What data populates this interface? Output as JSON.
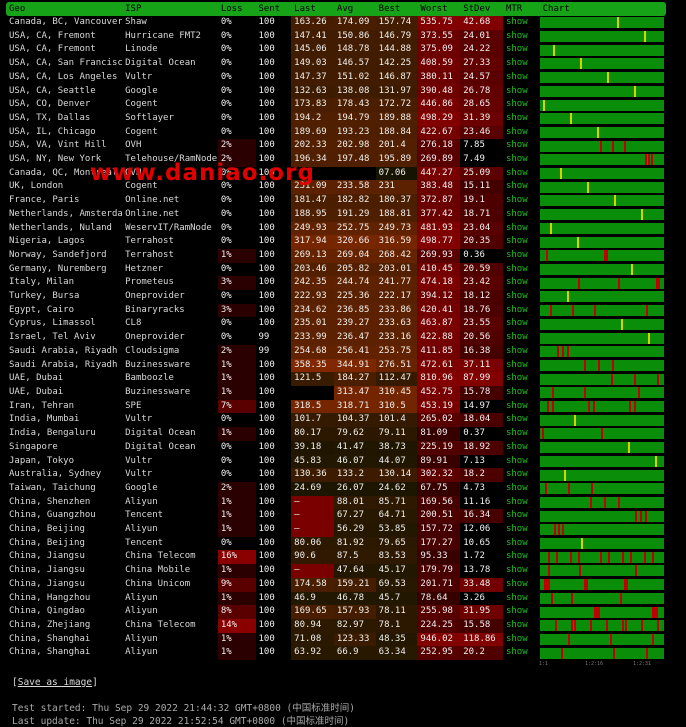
{
  "headers": [
    "Geo",
    "ISP",
    "Loss",
    "Sent",
    "Last",
    "Avg",
    "Best",
    "Worst",
    "StDev",
    "MTR",
    "Chart"
  ],
  "rows": [
    [
      "Canada, BC, Vancouver",
      "Shaw",
      "0%",
      "100",
      "163.26",
      "174.09",
      "157.74",
      "535.75",
      "42.68",
      "show"
    ],
    [
      "USA, CA, Fremont",
      "Hurricane FMT2",
      "0%",
      "100",
      "147.41",
      "150.86",
      "146.79",
      "373.55",
      "24.01",
      "show"
    ],
    [
      "USA, CA, Fremont",
      "Linode",
      "0%",
      "100",
      "145.06",
      "148.78",
      "144.88",
      "375.09",
      "24.22",
      "show"
    ],
    [
      "USA, CA, San Francisco",
      "Digital Ocean",
      "0%",
      "100",
      "149.03",
      "146.57",
      "142.25",
      "408.59",
      "27.33",
      "show"
    ],
    [
      "USA, CA, Los Angeles",
      "Vultr",
      "0%",
      "100",
      "147.37",
      "151.02",
      "146.87",
      "380.11",
      "24.57",
      "show"
    ],
    [
      "USA, CA, Seattle",
      "Google",
      "0%",
      "100",
      "132.63",
      "138.08",
      "131.97",
      "390.48",
      "26.78",
      "show"
    ],
    [
      "USA, CO, Denver",
      "Cogent",
      "0%",
      "100",
      "173.83",
      "178.43",
      "172.72",
      "446.86",
      "28.65",
      "show"
    ],
    [
      "USA, TX, Dallas",
      "Softlayer",
      "0%",
      "100",
      "194.2",
      "194.79",
      "189.88",
      "498.29",
      "31.39",
      "show"
    ],
    [
      "USA, IL, Chicago",
      "Cogent",
      "0%",
      "100",
      "189.69",
      "193.23",
      "188.84",
      "422.67",
      "23.46",
      "show"
    ],
    [
      "USA, VA, Vint Hill",
      "OVH",
      "2%",
      "100",
      "202.33",
      "202.98",
      "201.4",
      "276.18",
      "7.85",
      "show"
    ],
    [
      "USA, NY, New York",
      "Telehouse/RamNode",
      "2%",
      "100",
      "196.34",
      "197.48",
      "195.89",
      "269.89",
      "7.49",
      "show"
    ],
    [
      "Canada, QC, Montreal",
      "OVH",
      "0%",
      "100",
      "",
      "",
      "07.06",
      "447.27",
      "25.09",
      "show"
    ],
    [
      "UK, London",
      "Cogent",
      "0%",
      "100",
      "231.09",
      "233.58",
      "231",
      "383.48",
      "15.11",
      "show"
    ],
    [
      "France, Paris",
      "Online.net",
      "0%",
      "100",
      "181.47",
      "182.82",
      "180.37",
      "372.87",
      "19.1",
      "show"
    ],
    [
      "Netherlands, Amsterdam",
      "Online.net",
      "0%",
      "100",
      "188.95",
      "191.29",
      "188.81",
      "377.42",
      "18.71",
      "show"
    ],
    [
      "Netherlands, Nuland",
      "WeservIT/RamNode",
      "0%",
      "100",
      "249.93",
      "252.75",
      "249.73",
      "481.93",
      "23.04",
      "show"
    ],
    [
      "Nigeria, Lagos",
      "Terrahost",
      "0%",
      "100",
      "317.94",
      "320.66",
      "316.59",
      "498.77",
      "20.35",
      "show"
    ],
    [
      "Norway, Sandefjord",
      "Terrahost",
      "1%",
      "100",
      "269.13",
      "269.04",
      "268.42",
      "269.93",
      "0.36",
      "show"
    ],
    [
      "Germany, Nuremberg",
      "Hetzner",
      "0%",
      "100",
      "203.46",
      "205.82",
      "203.01",
      "410.45",
      "20.59",
      "show"
    ],
    [
      "Italy, Milan",
      "Prometeus",
      "3%",
      "100",
      "242.35",
      "244.74",
      "241.77",
      "474.18",
      "23.42",
      "show"
    ],
    [
      "Turkey, Bursa",
      "Oneprovider",
      "0%",
      "100",
      "222.93",
      "225.36",
      "222.17",
      "394.12",
      "18.12",
      "show"
    ],
    [
      "Egypt, Cairo",
      "Binaryracks",
      "3%",
      "100",
      "234.62",
      "236.85",
      "233.86",
      "420.41",
      "18.76",
      "show"
    ],
    [
      "Cyprus, Limassol",
      "CL8",
      "0%",
      "100",
      "235.01",
      "239.27",
      "233.63",
      "463.87",
      "23.55",
      "show"
    ],
    [
      "Israel, Tel Aviv",
      "Oneprovider",
      "0%",
      "99",
      "233.99",
      "236.47",
      "233.16",
      "422.88",
      "20.56",
      "show"
    ],
    [
      "Saudi Arabia, Riyadh",
      "Cloudsigma",
      "2%",
      "99",
      "254.68",
      "256.41",
      "253.75",
      "411.85",
      "16.38",
      "show"
    ],
    [
      "Saudi Arabia, Riyadh",
      "Buzinessware",
      "1%",
      "100",
      "358.35",
      "344.91",
      "276.51",
      "472.61",
      "37.11",
      "show"
    ],
    [
      "UAE, Dubai",
      "Bamboozle",
      "1%",
      "100",
      "121.5",
      "184.27",
      "112.47",
      "810.96",
      "87.99",
      "show"
    ],
    [
      "UAE, Dubai",
      "Buzinessware",
      "1%",
      "100",
      "",
      "313.47",
      "310.45",
      "452.75",
      "15.78",
      "show"
    ],
    [
      "Iran, Tehran",
      "SPE",
      "7%",
      "100",
      "318.5",
      "318.71",
      "310.5",
      "453.19",
      "14.97",
      "show"
    ],
    [
      "India, Mumbai",
      "Vultr",
      "0%",
      "100",
      "101.7",
      "104.37",
      "101.4",
      "265.02",
      "18.04",
      "show"
    ],
    [
      "India, Bengaluru",
      "Digital Ocean",
      "1%",
      "100",
      "80.17",
      "79.62",
      "79.11",
      "81.09",
      "0.37",
      "show"
    ],
    [
      "Singapore",
      "Digital Ocean",
      "0%",
      "100",
      "39.18",
      "41.47",
      "38.73",
      "225.19",
      "18.92",
      "show"
    ],
    [
      "Japan, Tokyo",
      "Vultr",
      "0%",
      "100",
      "45.83",
      "46.07",
      "44.07",
      "89.91",
      "7.13",
      "show"
    ],
    [
      "Australia, Sydney",
      "Vultr",
      "0%",
      "100",
      "130.36",
      "133.2",
      "130.14",
      "302.32",
      "18.2",
      "show"
    ],
    [
      "Taiwan, Taichung",
      "Google",
      "2%",
      "100",
      "24.69",
      "26.07",
      "24.62",
      "67.75",
      "4.73",
      "show"
    ],
    [
      "China, Shenzhen",
      "Aliyun",
      "1%",
      "100",
      "–",
      "88.01",
      "85.71",
      "169.56",
      "11.16",
      "show"
    ],
    [
      "China, Guangzhou",
      "Tencent",
      "1%",
      "100",
      "–",
      "67.27",
      "64.71",
      "200.51",
      "16.34",
      "show"
    ],
    [
      "China, Beijing",
      "Aliyun",
      "1%",
      "100",
      "–",
      "56.29",
      "53.85",
      "157.72",
      "12.06",
      "show"
    ],
    [
      "China, Beijing",
      "Tencent",
      "0%",
      "100",
      "80.06",
      "81.92",
      "79.65",
      "177.27",
      "10.65",
      "show"
    ],
    [
      "China, Jiangsu",
      "China Telecom",
      "16%",
      "100",
      "90.6",
      "87.5",
      "83.53",
      "95.33",
      "1.72",
      "show"
    ],
    [
      "China, Jiangsu",
      "China Mobile",
      "1%",
      "100",
      "–",
      "47.64",
      "45.17",
      "179.79",
      "13.78",
      "show"
    ],
    [
      "China, Jiangsu",
      "China Unicom",
      "9%",
      "100",
      "174.58",
      "159.21",
      "69.53",
      "201.71",
      "33.48",
      "show"
    ],
    [
      "China, Hangzhou",
      "Aliyun",
      "1%",
      "100",
      "46.9",
      "46.78",
      "45.7",
      "78.64",
      "3.26",
      "show"
    ],
    [
      "China, Qingdao",
      "Aliyun",
      "8%",
      "100",
      "169.65",
      "157.93",
      "78.11",
      "255.98",
      "31.95",
      "show"
    ],
    [
      "China, Zhejiang",
      "China Telecom",
      "14%",
      "100",
      "80.94",
      "82.97",
      "78.1",
      "224.25",
      "15.58",
      "show"
    ],
    [
      "China, Shanghai",
      "Aliyun",
      "1%",
      "100",
      "71.08",
      "123.33",
      "48.35",
      "946.02",
      "118.86",
      "show"
    ],
    [
      "China, Shanghai",
      "Aliyun",
      "1%",
      "100",
      "63.92",
      "66.9",
      "63.34",
      "252.95",
      "20.2",
      "show"
    ]
  ],
  "watermark": "www.daniao.org",
  "chart_axis": [
    "1:1",
    "1:2:16",
    "1:2:31"
  ],
  "save_link": "Save as image",
  "test_started": "Test started: Thu Sep 29 2022 21:44:32 GMT+0800 (中国标准时间)",
  "last_update": "Last update: Thu Sep 29 2022 21:52:54 GMT+0800 (中国标准时间)",
  "colors": {
    "header_bg": "#17a317",
    "chart_green": "#0a8e0a",
    "link_green": "#1fc11f"
  }
}
